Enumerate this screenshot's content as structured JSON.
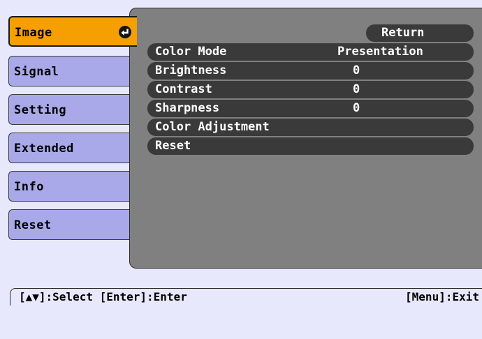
{
  "sidebar": {
    "items": [
      {
        "label": "Image",
        "active": true
      },
      {
        "label": "Signal"
      },
      {
        "label": "Setting"
      },
      {
        "label": "Extended"
      },
      {
        "label": "Info"
      },
      {
        "label": "Reset"
      }
    ],
    "active_icon": "enter-return-icon",
    "active_color": "#f5a000",
    "item_color": "#a9a9ea"
  },
  "panel": {
    "return_label": "Return",
    "rows": [
      {
        "label": "Color Mode",
        "value": "Presentation"
      },
      {
        "label": "Brightness",
        "value": "0"
      },
      {
        "label": "Contrast",
        "value": "0"
      },
      {
        "label": "Sharpness",
        "value": "0"
      },
      {
        "label": "Color Adjustment",
        "value": ""
      },
      {
        "label": "Reset",
        "value": ""
      }
    ],
    "background_color": "#808080",
    "row_color": "#3a3a3a"
  },
  "footer": {
    "left": "[▲▼]:Select [Enter]:Enter",
    "right": "[Menu]:Exit"
  }
}
